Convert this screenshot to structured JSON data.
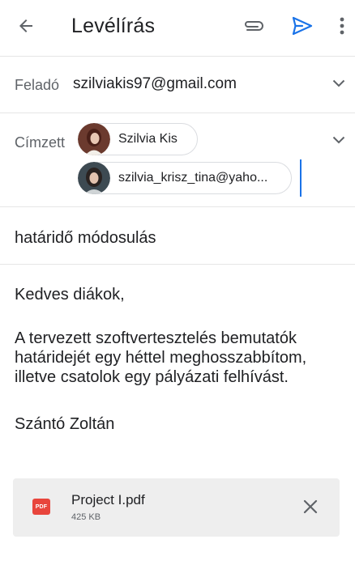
{
  "header": {
    "title": "Levélírás",
    "back_icon": "arrow-back-icon",
    "attach_icon": "paperclip-icon",
    "send_icon": "send-icon",
    "more_icon": "more-vert-icon",
    "accent_color": "#1a73e8"
  },
  "from": {
    "label": "Feladó",
    "value": "szilviakis97@gmail.com"
  },
  "to": {
    "label": "Címzett",
    "recipients": [
      {
        "name": "Szilvia Kis"
      },
      {
        "name": "szilvia_krisz_tina@yaho..."
      }
    ]
  },
  "subject": "határidő módosulás",
  "body": {
    "greeting": "Kedves diákok,",
    "paragraph": "A tervezett szoftvertesztelés bemutatók határidejét egy héttel meghosszabbítom, illetve csatolok egy pályázati felhívást.",
    "signature": "Szántó Zoltán"
  },
  "attachment": {
    "file_name": "Project I.pdf",
    "file_size": "425 KB",
    "type_label": "PDF",
    "type_color": "#e8453c",
    "close_icon": "close-icon"
  }
}
